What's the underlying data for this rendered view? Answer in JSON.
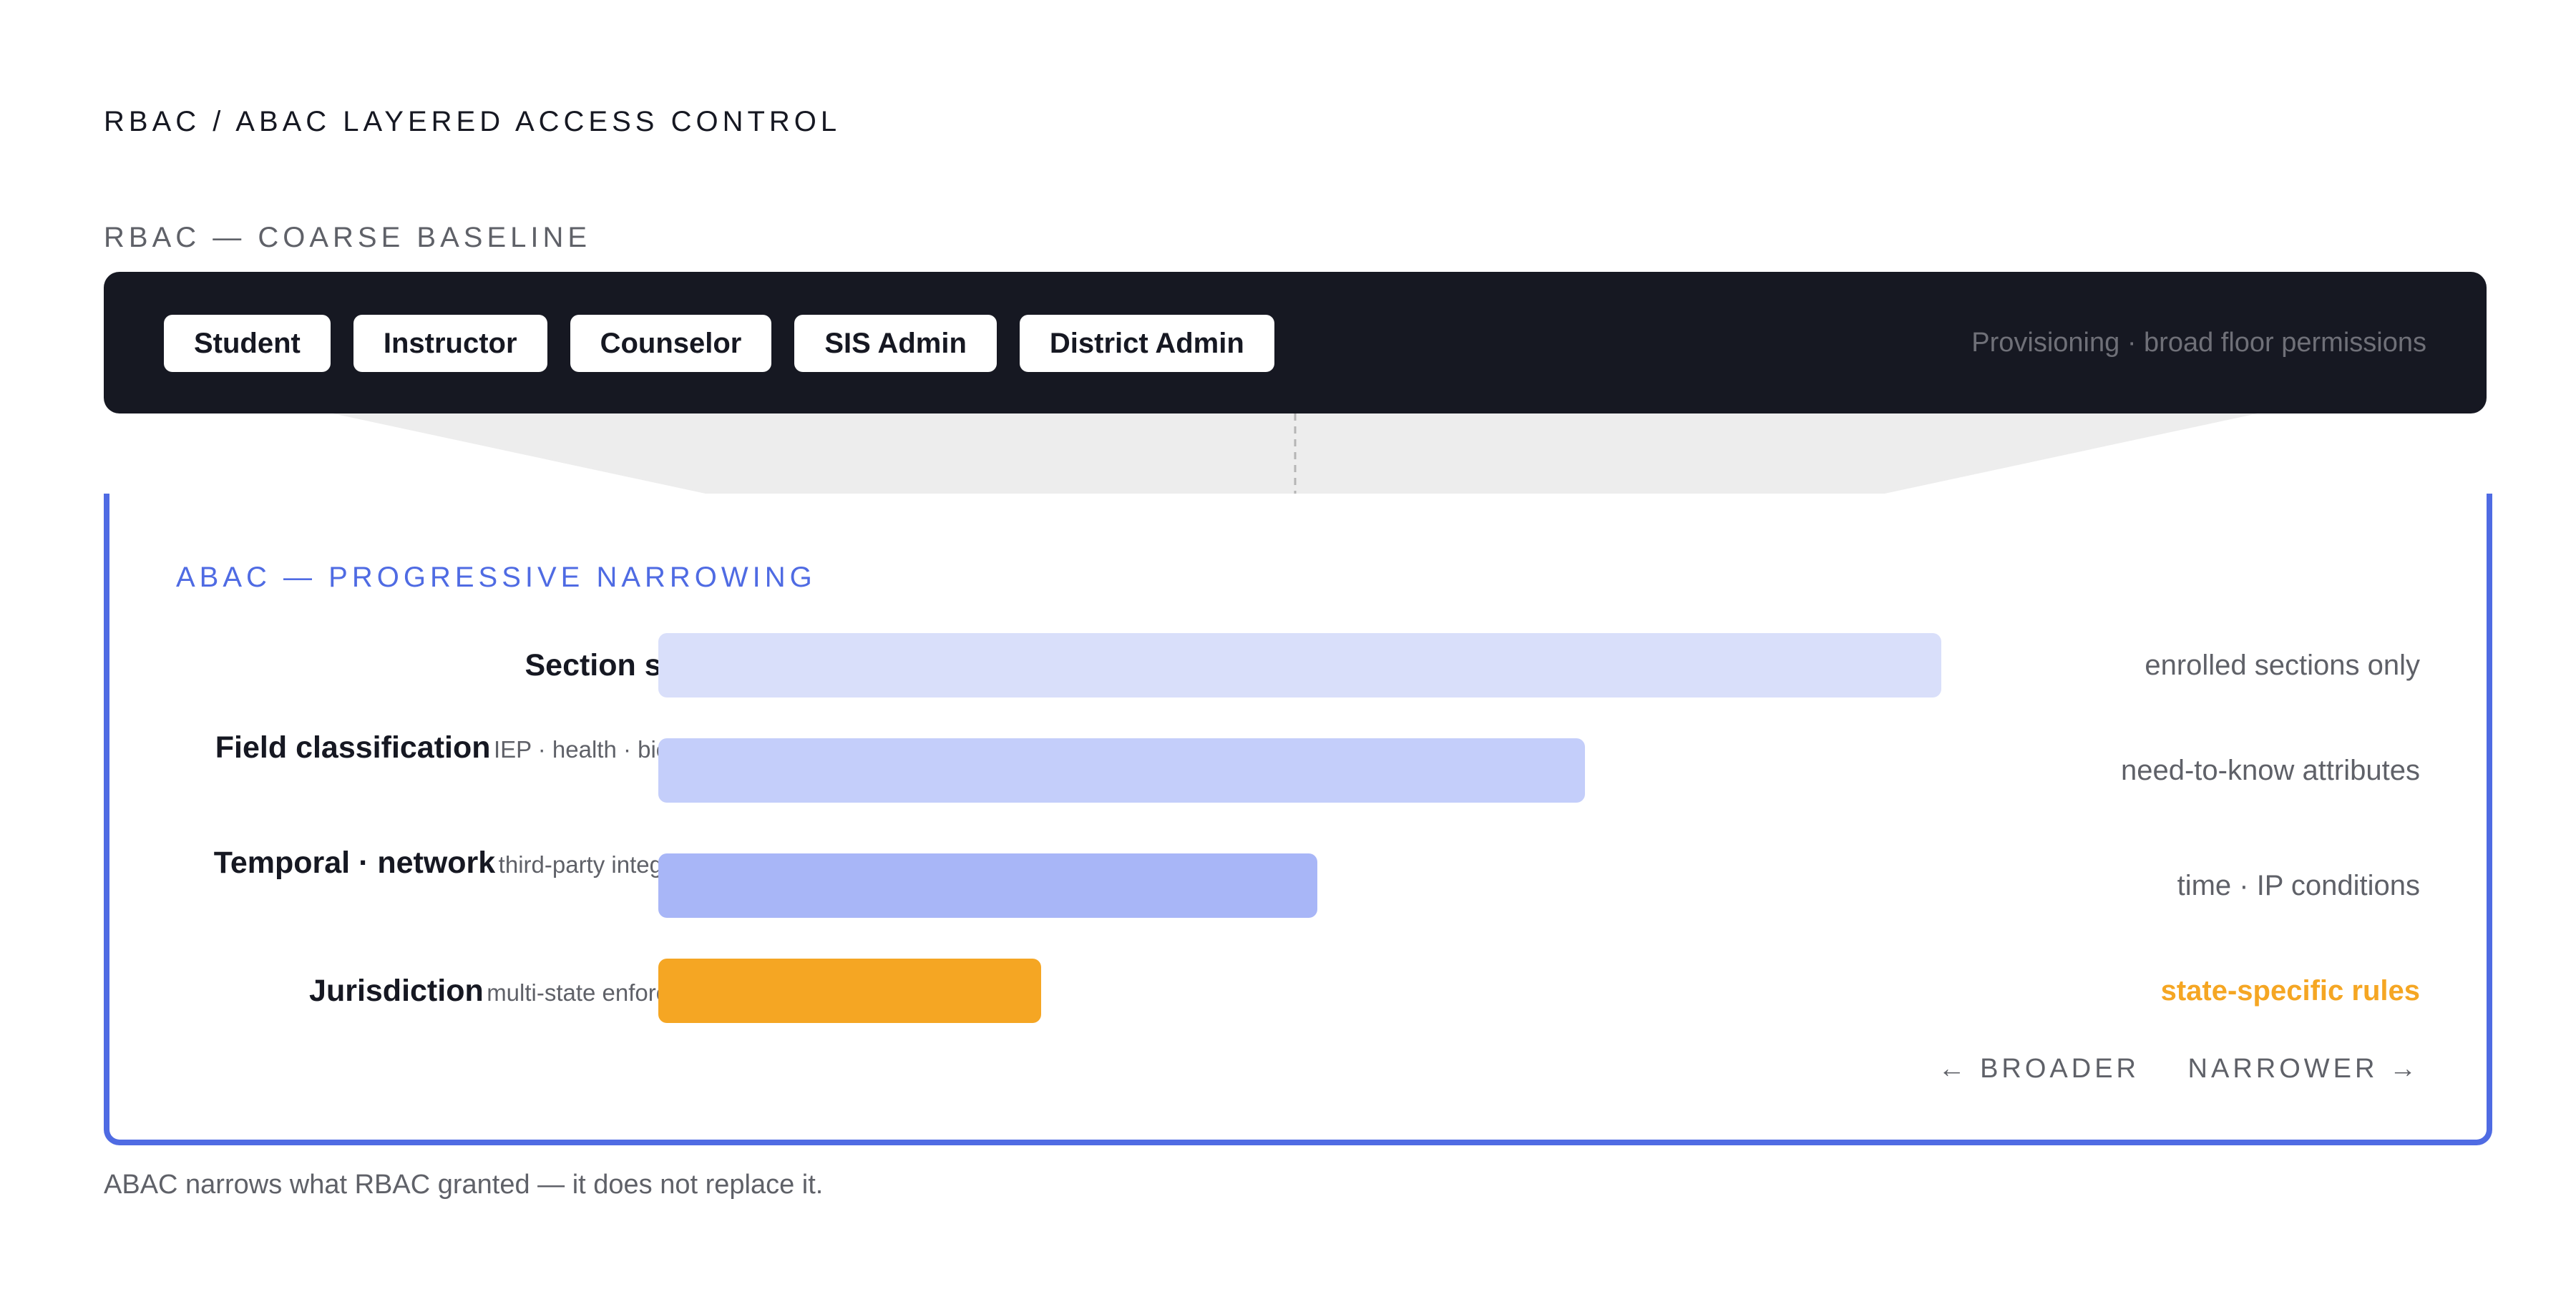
{
  "title": "RBAC / ABAC LAYERED ACCESS CONTROL",
  "rbac": {
    "label": "RBAC — COARSE BASELINE",
    "roles": [
      "Student",
      "Instructor",
      "Counselor",
      "SIS Admin",
      "District Admin"
    ],
    "note": "Provisioning · broad floor permissions"
  },
  "abac": {
    "label": "ABAC — PROGRESSIVE NARROWING",
    "layers": [
      {
        "name": "Section scope",
        "sub": "",
        "note": "enrolled sections only",
        "scope": 0.72,
        "color": "#d9dffa",
        "note_color": "#5f6168"
      },
      {
        "name": "Field classification",
        "sub": "IEP · health · biometric",
        "note": "need-to-know attributes",
        "scope": 0.52,
        "color": "#c4cefa",
        "note_color": "#5f6168"
      },
      {
        "name": "Temporal · network",
        "sub": "third-party integrations",
        "note": "time · IP conditions",
        "scope": 0.37,
        "color": "#a8b6f7",
        "note_color": "#5f6168"
      },
      {
        "name": "Jurisdiction",
        "sub": "multi-state enforcement",
        "note": "state-specific rules",
        "scope": 0.215,
        "color": "#f5a623",
        "note_color": "#f5a623"
      }
    ],
    "axis_broader": "← BROADER",
    "axis_narrower": "NARROWER →"
  },
  "footer": "ABAC narrows what RBAC granted — it does not replace it."
}
